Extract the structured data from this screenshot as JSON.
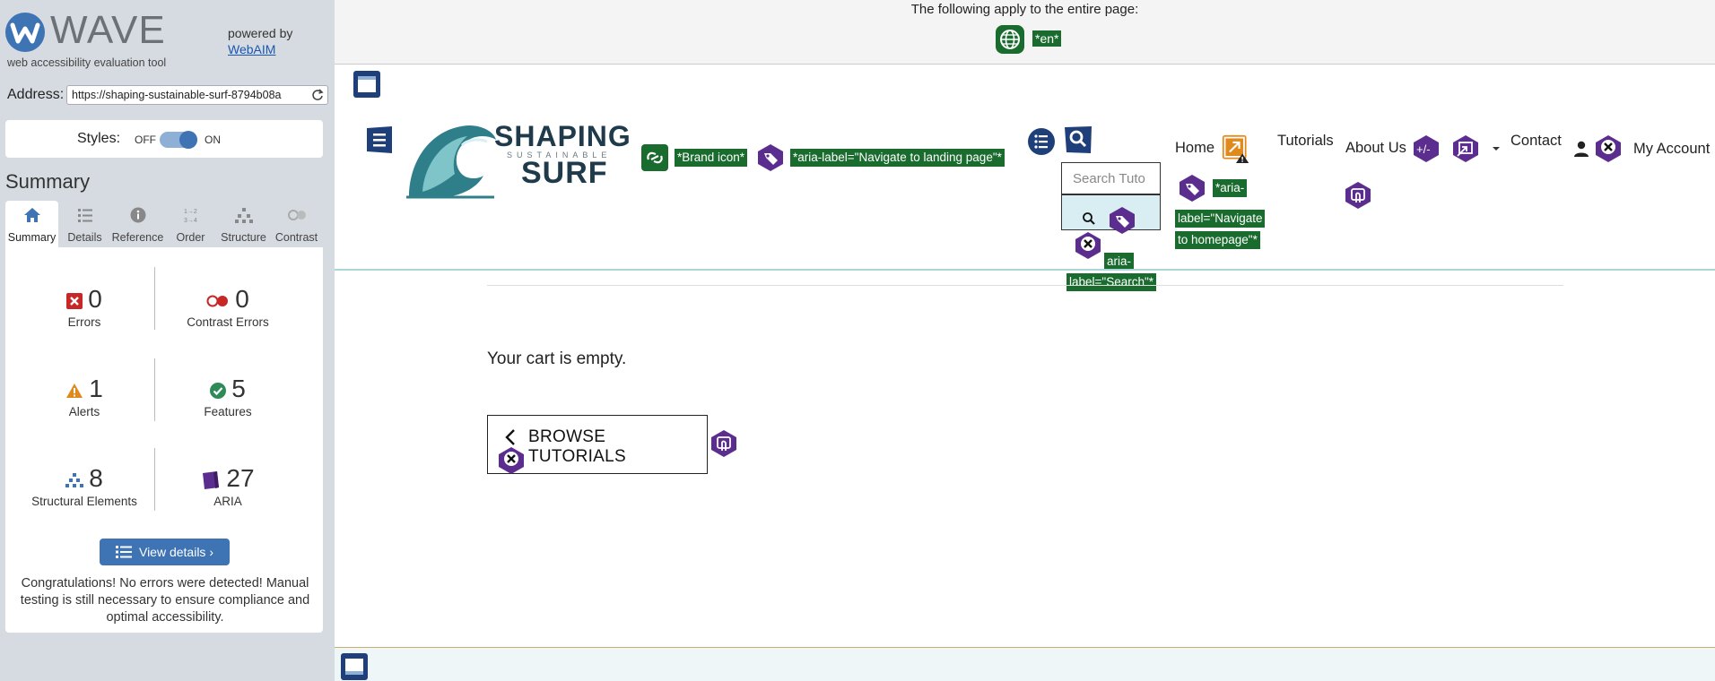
{
  "sidebar": {
    "brand": "WAVE",
    "tagline": "web accessibility evaluation tool",
    "powered_by": "powered by",
    "powered_link": "WebAIM",
    "address_label": "Address:",
    "address_value": "https://shaping-sustainable-surf-8794b08a",
    "styles_label": "Styles:",
    "styles_off": "OFF",
    "styles_on": "ON",
    "summary_title": "Summary",
    "tabs": [
      {
        "label": "Summary",
        "icon": "home-icon"
      },
      {
        "label": "Details",
        "icon": "list-icon"
      },
      {
        "label": "Reference",
        "icon": "info-icon"
      },
      {
        "label": "Order",
        "icon": "order-icon"
      },
      {
        "label": "Structure",
        "icon": "structure-icon"
      },
      {
        "label": "Contrast",
        "icon": "contrast-icon"
      }
    ],
    "stats": {
      "errors": {
        "value": "0",
        "label": "Errors"
      },
      "contrast_errors": {
        "value": "0",
        "label": "Contrast Errors"
      },
      "alerts": {
        "value": "1",
        "label": "Alerts"
      },
      "features": {
        "value": "5",
        "label": "Features"
      },
      "structural": {
        "value": "8",
        "label": "Structural Elements"
      },
      "aria": {
        "value": "27",
        "label": "ARIA"
      }
    },
    "view_details": "View details ›",
    "congrats": "Congratulations! No errors were detected! Manual testing is still necessary to ensure compliance and optimal accessibility."
  },
  "main": {
    "notice": "The following apply to the entire page:",
    "lang_badge": "*en*",
    "logo": {
      "shaping": "SHAPING",
      "sustainable": "SUSTAINABLE",
      "surf": "SURF"
    },
    "brand_icon_label": "*Brand icon*",
    "landing_label": "*aria-label=\"Navigate to landing page\"*",
    "search_placeholder": "Search Tuto",
    "search_aria_1": "aria-",
    "search_aria_2": "label=\"Search\"*",
    "home_aria_1": "*aria-",
    "home_aria_2": "label=\"Navigate",
    "home_aria_3": "to homepage\"*",
    "nav": {
      "home": "Home",
      "tutorials": "Tutorials",
      "about": "About Us",
      "contact": "Contact",
      "account": "My Account"
    },
    "cart_empty": "Your cart is empty.",
    "browse_btn": "BROWSE TUTORIALS"
  },
  "colors": {
    "wave_blue": "#3e73b4",
    "aria_purple": "#5b2d8e",
    "structure_navy": "#1f3f7a",
    "feature_green": "#1a6b2e",
    "alert_orange": "#e08a1e",
    "error_red": "#c62828"
  }
}
